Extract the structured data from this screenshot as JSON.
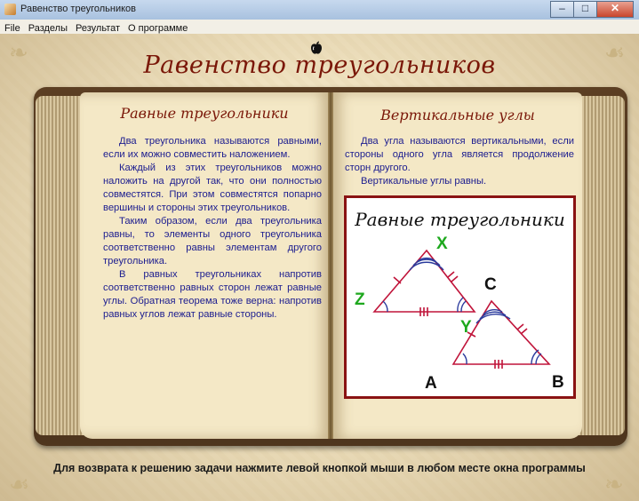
{
  "window": {
    "title": "Равенство треугольников",
    "buttons": {
      "minimize": "–",
      "maximize": "□",
      "close": "✕"
    }
  },
  "menu": [
    "File",
    "Разделы",
    "Результат",
    "О программе"
  ],
  "page_title": "Равенство треугольников",
  "left_page": {
    "heading": "Равные треугольники",
    "paragraphs": [
      "Два треугольника называются равными, если их можно совместить наложением.",
      "Каждый из этих треугольников можно наложить на другой так, что они полностью совместятся. При этом совместятся попарно вершины и стороны этих треугольников.",
      "Таким образом, если два треугольника равны, то элементы одного треугольника соответственно равны элементам другого треугольника.",
      "В равных треугольниках напротив соответственно равных сторон лежат равные углы. Обратная теорема тоже верна: напротив равных углов лежат равные стороны."
    ]
  },
  "right_page": {
    "heading": "Вертикальные углы",
    "paragraphs": [
      "Два угла называются вертикальными, если стороны одного угла является продолжение сторн другого.",
      "Вертикальные углы равны."
    ],
    "figure": {
      "title": "Равные треугольники",
      "labels": {
        "X": "X",
        "Y": "Y",
        "Z": "Z",
        "A": "A",
        "B": "B",
        "C": "C"
      },
      "colors": {
        "triangle_lines": "#c0143a",
        "arcs": "#2a3a9c",
        "green_labels": "#1ea81e",
        "black_labels": "#111111"
      }
    }
  },
  "footer": "Для возврата к решению задачи нажмите левой кнопкой мыши в любом месте окна программы",
  "icons": {
    "app": "triangle-app-icon",
    "logo": "apple-logo-icon"
  }
}
